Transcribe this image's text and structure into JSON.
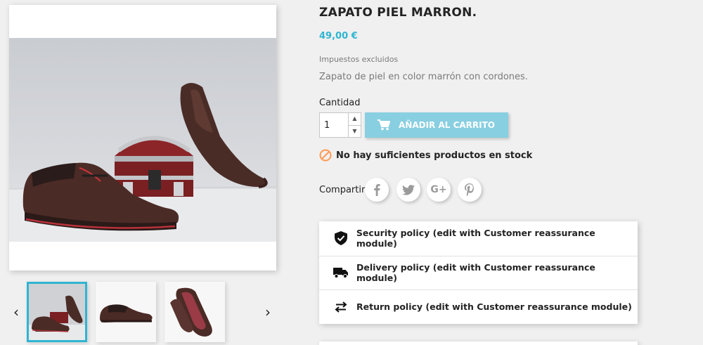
{
  "product": {
    "title": "ZAPATO PIEL MARRON.",
    "price": "49,00 €",
    "tax_note": "Impuestos excluidos",
    "description": "Zapato de piel en color marrón con cordones."
  },
  "images": {
    "thumbnails": [
      {
        "alt": "shoe-with-chest",
        "selected": true
      },
      {
        "alt": "shoe-side-view",
        "selected": false
      },
      {
        "alt": "shoe-sole-view",
        "selected": false
      }
    ]
  },
  "quantity": {
    "label": "Cantidad",
    "value": "1"
  },
  "add_to_cart": {
    "label": "AÑADIR AL CARRITO",
    "icon": "shopping-cart-icon"
  },
  "stock": {
    "message": "No hay suficientes productos en stock",
    "icon": "ban-icon"
  },
  "share": {
    "label": "Compartir",
    "networks": [
      {
        "name": "facebook",
        "glyph": "f"
      },
      {
        "name": "twitter",
        "glyph": "t"
      },
      {
        "name": "google-plus",
        "glyph": "G+"
      },
      {
        "name": "pinterest",
        "glyph": "p"
      }
    ]
  },
  "reassurance": [
    {
      "icon": "shield-check-icon",
      "text": "Security policy (edit with Customer reassurance module)"
    },
    {
      "icon": "truck-icon",
      "text": "Delivery policy (edit with Customer reassurance module)"
    },
    {
      "icon": "swap-arrows-icon",
      "text": "Return policy (edit with Customer reassurance module)"
    }
  ],
  "colors": {
    "accent": "#2fb5d2",
    "button_disabled": "#88cfe1",
    "stock_warning": "#ff9a52",
    "background": "#f0f0f0"
  }
}
